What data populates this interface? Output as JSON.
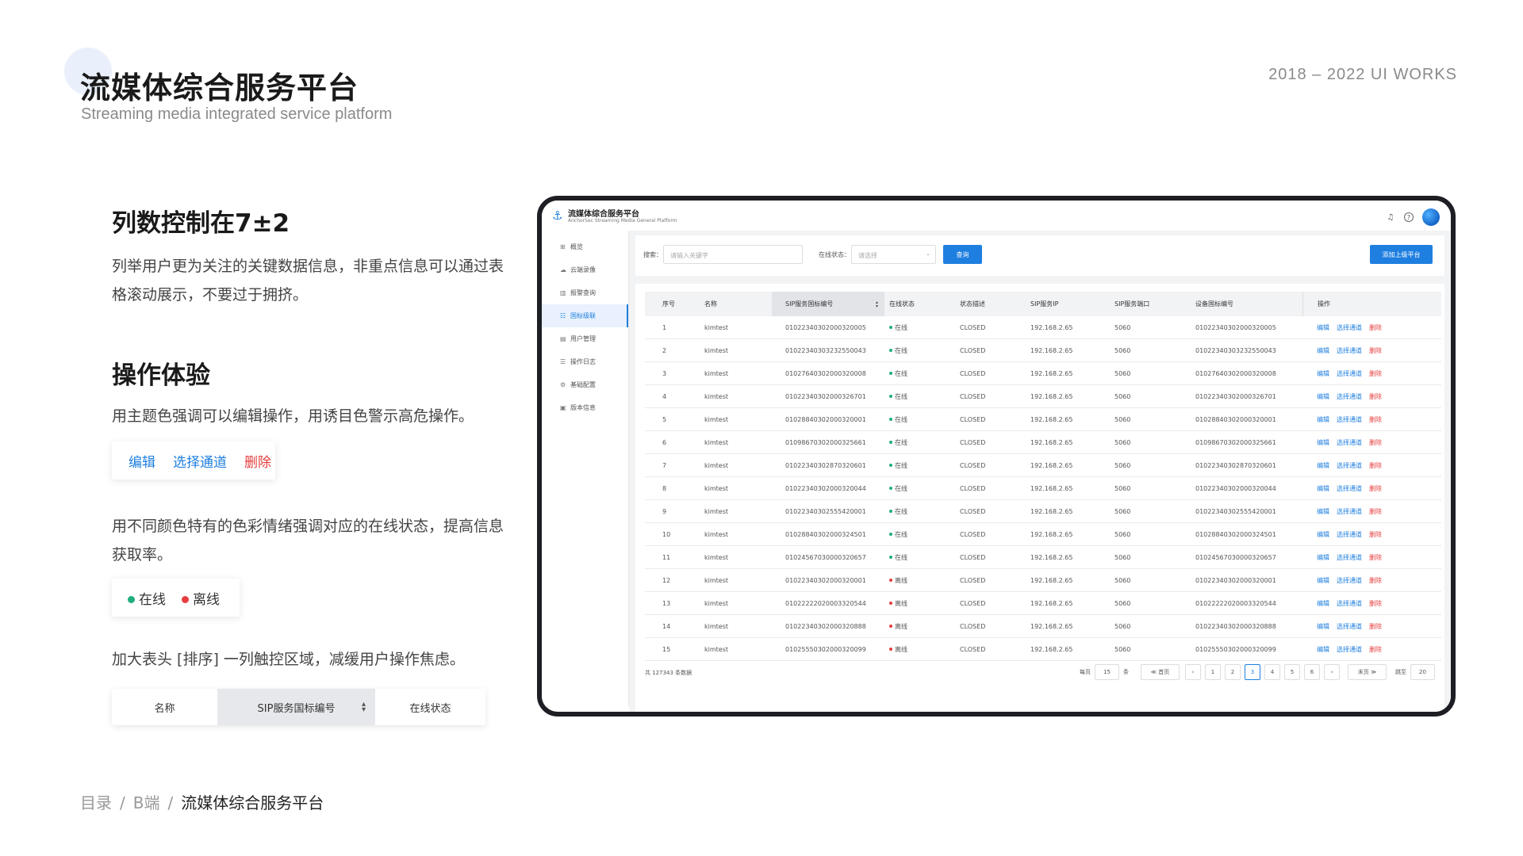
{
  "header": {
    "title": "流媒体综合服务平台",
    "subtitle": "Streaming media integrated service platform",
    "works": "2018 – 2022 UI WORKS"
  },
  "sections": {
    "columns_heading": "列数控制在7±2",
    "columns_text": "列举用户更为关注的关键数据信息，非重点信息可以通过表格滚动展示，不要过于拥挤。",
    "ops_heading": "操作体验",
    "ops_text": "用主题色强调可以编辑操作，用诱目色警示高危操作。",
    "ops_edit": "编辑",
    "ops_select": "选择通道",
    "ops_delete": "删除",
    "status_text": "用不同颜色特有的色彩情绪强调对应的在线状态，提高信息获取率。",
    "status_online": "在线",
    "status_offline": "离线",
    "sort_text": "加大表头 [排序] 一列触控区域，减缓用户操作焦虑。",
    "sort_col_name": "名称",
    "sort_col_sip": "SIP服务国标编号",
    "sort_col_status": "在线状态"
  },
  "breadcrumb": {
    "items": [
      "目录",
      "B端",
      "流媒体综合服务平台"
    ]
  },
  "colors": {
    "primary": "#1f7fe0",
    "danger": "#e63e3e",
    "online": "#1fae7c"
  },
  "app": {
    "name": "流媒体综合服务平台",
    "name_en": "AnchorSec Streaming Media General Platform",
    "sidebar": [
      {
        "label": "概览",
        "icon": "dashboard-icon"
      },
      {
        "label": "云端录像",
        "icon": "cloud-icon"
      },
      {
        "label": "报警查询",
        "icon": "chart-icon"
      },
      {
        "label": "国标级联",
        "icon": "cascade-icon",
        "active": true
      },
      {
        "label": "用户管理",
        "icon": "user-icon"
      },
      {
        "label": "操作日志",
        "icon": "log-icon"
      },
      {
        "label": "基础配置",
        "icon": "settings-icon"
      },
      {
        "label": "版本信息",
        "icon": "info-icon"
      }
    ],
    "filter": {
      "search_label": "搜索：",
      "search_placeholder": "请输入关键字",
      "status_label": "在线状态：",
      "status_placeholder": "请选择",
      "query_button": "查询",
      "add_button": "添加上级平台"
    },
    "table": {
      "headers": [
        "序号",
        "名称",
        "SIP服务国标编号",
        "在线状态",
        "状态描述",
        "SIP服务IP",
        "SIP服务端口",
        "设备国标编号",
        "操作"
      ],
      "rows": [
        {
          "no": "1",
          "name": "kimtest",
          "sip": "01022340302000320005",
          "status": "在线",
          "online": true,
          "desc": "CLOSED",
          "ip": "192.168.2.65",
          "port": "5060",
          "device": "01022340302000320005"
        },
        {
          "no": "2",
          "name": "kimtest",
          "sip": "01022340303232550043",
          "status": "在线",
          "online": true,
          "desc": "CLOSED",
          "ip": "192.168.2.65",
          "port": "5060",
          "device": "01022340303232550043"
        },
        {
          "no": "3",
          "name": "kimtest",
          "sip": "01027640302000320008",
          "status": "在线",
          "online": true,
          "desc": "CLOSED",
          "ip": "192.168.2.65",
          "port": "5060",
          "device": "01027640302000320008"
        },
        {
          "no": "4",
          "name": "kimtest",
          "sip": "01022340302000326701",
          "status": "在线",
          "online": true,
          "desc": "CLOSED",
          "ip": "192.168.2.65",
          "port": "5060",
          "device": "01022340302000326701"
        },
        {
          "no": "5",
          "name": "kimtest",
          "sip": "01028840302000320001",
          "status": "在线",
          "online": true,
          "desc": "CLOSED",
          "ip": "192.168.2.65",
          "port": "5060",
          "device": "01028840302000320001"
        },
        {
          "no": "6",
          "name": "kimtest",
          "sip": "01098670302000325661",
          "status": "在线",
          "online": true,
          "desc": "CLOSED",
          "ip": "192.168.2.65",
          "port": "5060",
          "device": "01098670302000325661"
        },
        {
          "no": "7",
          "name": "kimtest",
          "sip": "01022340302870320601",
          "status": "在线",
          "online": true,
          "desc": "CLOSED",
          "ip": "192.168.2.65",
          "port": "5060",
          "device": "01022340302870320601"
        },
        {
          "no": "8",
          "name": "kimtest",
          "sip": "01022340302000320044",
          "status": "在线",
          "online": true,
          "desc": "CLOSED",
          "ip": "192.168.2.65",
          "port": "5060",
          "device": "01022340302000320044"
        },
        {
          "no": "9",
          "name": "kimtest",
          "sip": "01022340302555420001",
          "status": "在线",
          "online": true,
          "desc": "CLOSED",
          "ip": "192.168.2.65",
          "port": "5060",
          "device": "01022340302555420001"
        },
        {
          "no": "10",
          "name": "kimtest",
          "sip": "01028840302000324501",
          "status": "在线",
          "online": true,
          "desc": "CLOSED",
          "ip": "192.168.2.65",
          "port": "5060",
          "device": "01028840302000324501"
        },
        {
          "no": "11",
          "name": "kimtest",
          "sip": "01024567030000320657",
          "status": "在线",
          "online": true,
          "desc": "CLOSED",
          "ip": "192.168.2.65",
          "port": "5060",
          "device": "01024567030000320657"
        },
        {
          "no": "12",
          "name": "kimtest",
          "sip": "01022340302000320001",
          "status": "离线",
          "online": false,
          "desc": "CLOSED",
          "ip": "192.168.2.65",
          "port": "5060",
          "device": "01022340302000320001"
        },
        {
          "no": "13",
          "name": "kimtest",
          "sip": "01022222020003320544",
          "status": "离线",
          "online": false,
          "desc": "CLOSED",
          "ip": "192.168.2.65",
          "port": "5060",
          "device": "01022222020003320544"
        },
        {
          "no": "14",
          "name": "kimtest",
          "sip": "01022340302000320888",
          "status": "离线",
          "online": false,
          "desc": "CLOSED",
          "ip": "192.168.2.65",
          "port": "5060",
          "device": "01022340302000320888"
        },
        {
          "no": "15",
          "name": "kimtest",
          "sip": "01025550302000320099",
          "status": "离线",
          "online": false,
          "desc": "CLOSED",
          "ip": "192.168.2.65",
          "port": "5060",
          "device": "01025550302000320099"
        }
      ],
      "actions": {
        "edit": "编辑",
        "select": "选择通道",
        "delete": "删除"
      }
    },
    "pager": {
      "total": "共 127343 条数据",
      "per_page_label": "每页",
      "per_page_value": "15",
      "per_page_unit": "条",
      "first": "≪ 首页",
      "prev": "‹",
      "pages": [
        "1",
        "2",
        "3",
        "4",
        "5",
        "6"
      ],
      "current_page": "3",
      "next": "›",
      "last": "末页 ≫",
      "goto_label": "跳至",
      "goto_value": "20"
    }
  }
}
